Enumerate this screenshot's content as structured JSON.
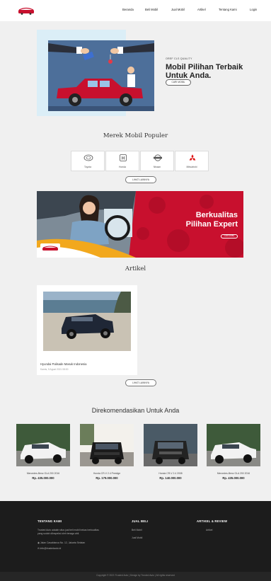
{
  "header": {
    "logo_text": "TRUSTED AUTO",
    "nav": [
      "Beranda",
      "Beli Mobil",
      "Jual Mobil",
      "Artikel",
      "Tentang Kami",
      "Login"
    ]
  },
  "hero": {
    "subtitle": "OREF CLS QUALITY",
    "title": "Mobil Pilihan Terbaik Untuk Anda.",
    "button": "CARI MOBIL"
  },
  "brands": {
    "title": "Merek Mobil Populer",
    "items": [
      {
        "name": "Toyota",
        "icon": "toyota-logo-icon"
      },
      {
        "name": "Honda",
        "icon": "honda-logo-icon"
      },
      {
        "name": "Nissan",
        "icon": "nissan-logo-icon"
      },
      {
        "name": "Mitsubishi",
        "icon": "mitsubishi-logo-icon"
      }
    ],
    "more_button": "LIHAT LAINNYA"
  },
  "banner": {
    "title_line1": "Berkualitas",
    "title_line2": "Pilihan Expert",
    "button": "CARI MOBIL",
    "logo_text": "TRUSTED AUTO"
  },
  "articles": {
    "title": "Artikel",
    "items": [
      {
        "title": "Hyundai Palisade Masuk Indonesia",
        "date": "Kamis, 5 Agust 2021 08:00"
      }
    ],
    "more_button": "LIHAT LAINNYA"
  },
  "recommend": {
    "title": "Direkomendasikan Untuk Anda",
    "items": [
      {
        "name": "Mercedes-Benz GLA 200 2016",
        "price": "Rp. 435.000.000",
        "color": "#f2f2f2"
      },
      {
        "name": "Honda CR-V 2.4 Prestige",
        "price": "Rp. 179.000.000",
        "color": "#1b1b1b"
      },
      {
        "name": "Honda CR-V 2.4 2008",
        "price": "Rp. 140.000.000",
        "color": "#232323"
      },
      {
        "name": "Mercedes-Benz GLA 200 2016",
        "price": "Rp. 435.000.000",
        "color": "#f2f2f2"
      }
    ]
  },
  "footer": {
    "col1": {
      "heading": "TENTANG KAMI",
      "text": "Trusted Auto adalah situs jual beli mobil bekas berkualitas yang sudah diinspeksi oleh tenaga ahli.",
      "address": "Jalan Casablanca No. 12, Jakarta Selatan",
      "email": "info@trustedauto.id"
    },
    "col2": {
      "heading": "JUAL BELI",
      "links": [
        "Beli Mobil",
        "Jual Mobil"
      ]
    },
    "col3": {
      "heading": "ARTIKEL & REVIEW",
      "links": [
        "Artikel"
      ]
    },
    "copyright": "Copyright © 2021 Trusted Auto | Design by Trusted Auto | All rights reserved"
  },
  "colors": {
    "brand_red": "#c8102e",
    "footer_bg": "#1c1c1c",
    "hero_blue": "#4d6f9a"
  }
}
